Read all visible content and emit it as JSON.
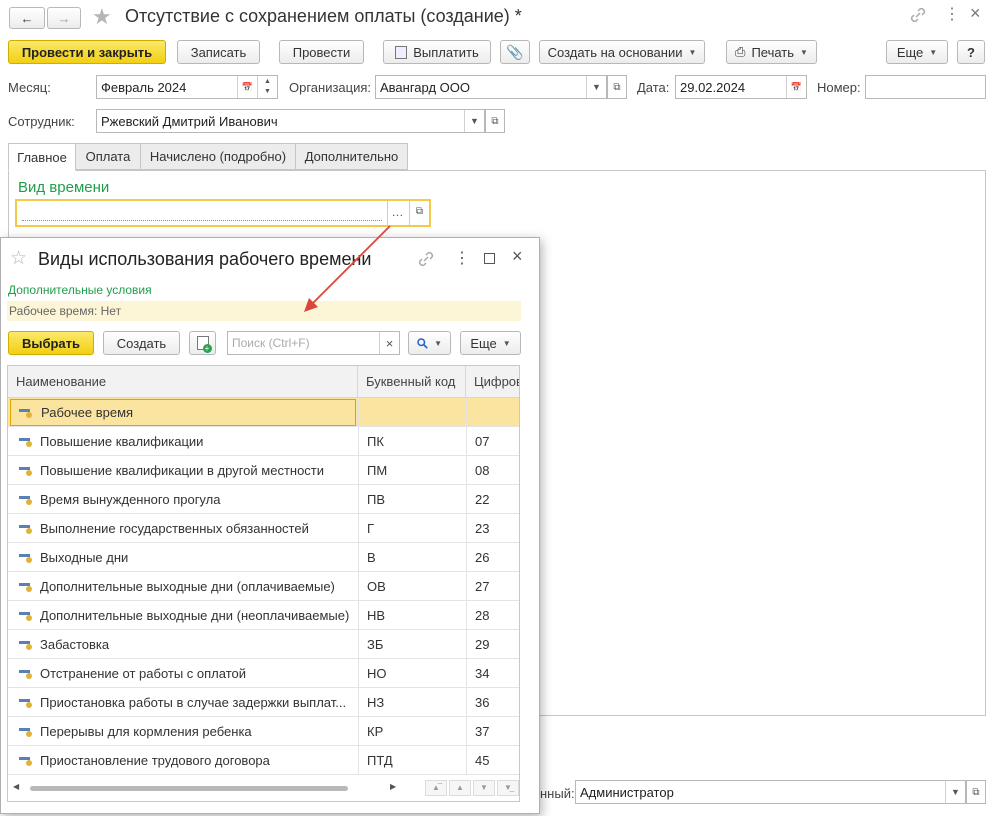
{
  "window": {
    "title": "Отсутствие с сохранением оплаты (создание) *"
  },
  "toolbar": {
    "post_close": "Провести и закрыть",
    "save": "Записать",
    "post": "Провести",
    "pay": "Выплатить",
    "create_based": "Создать на основании",
    "print": "Печать",
    "more": "Еще",
    "help": "?"
  },
  "form": {
    "month_label": "Месяц:",
    "month_value": "Февраль 2024",
    "org_label": "Организация:",
    "org_value": "Авангард ООО",
    "date_label": "Дата:",
    "date_value": "29.02.2024",
    "number_label": "Номер:",
    "number_value": "",
    "employee_label": "Сотрудник:",
    "employee_value": "Ржевский Дмитрий Иванович"
  },
  "tabs": [
    {
      "label": "Главное"
    },
    {
      "label": "Оплата"
    },
    {
      "label": "Начислено (подробно)"
    },
    {
      "label": "Дополнительно"
    }
  ],
  "main": {
    "time_type_label": "Вид времени",
    "time_type_value": "",
    "responsible_label": "нный:",
    "responsible_value": "Администратор"
  },
  "dialog": {
    "title": "Виды использования рабочего времени",
    "extra_conditions": "Дополнительные условия",
    "filter_text": "Рабочее время: Нет",
    "select_btn": "Выбрать",
    "create_btn": "Создать",
    "search_placeholder": "Поиск (Ctrl+F)",
    "more_btn": "Еще",
    "columns": [
      "Наименование",
      "Буквенный код",
      "Цифровой код"
    ],
    "rows": [
      {
        "name": "Рабочее время",
        "code": "",
        "num": ""
      },
      {
        "name": "Повышение квалификации",
        "code": "ПК",
        "num": "07"
      },
      {
        "name": "Повышение квалификации в другой местности",
        "code": "ПМ",
        "num": "08"
      },
      {
        "name": "Время вынужденного прогула",
        "code": "ПВ",
        "num": "22"
      },
      {
        "name": "Выполнение государственных обязанностей",
        "code": "Г",
        "num": "23"
      },
      {
        "name": "Выходные дни",
        "code": "В",
        "num": "26"
      },
      {
        "name": "Дополнительные выходные дни (оплачиваемые)",
        "code": "ОВ",
        "num": "27"
      },
      {
        "name": "Дополнительные выходные дни (неоплачиваемые)",
        "code": "НВ",
        "num": "28"
      },
      {
        "name": "Забастовка",
        "code": "ЗБ",
        "num": "29"
      },
      {
        "name": "Отстранение от работы с оплатой",
        "code": "НО",
        "num": "34"
      },
      {
        "name": "Приостановка работы в случае задержки выплат...",
        "code": "НЗ",
        "num": "36"
      },
      {
        "name": "Перерывы для кормления ребенка",
        "code": "КР",
        "num": "37"
      },
      {
        "name": "Приостановление трудового договора",
        "code": "ПТД",
        "num": "45"
      }
    ]
  },
  "colors": {
    "accent_yellow": "#f5d418",
    "green_text": "#1f9e4a",
    "selected_row": "#fbe4a0",
    "filter_bg": "#fcf6d7",
    "arrow": "#d9463a"
  },
  "icons": [
    "back-arrow-icon",
    "forward-arrow-icon",
    "star-icon",
    "link-icon",
    "kebab-menu-icon",
    "maximize-icon",
    "close-icon",
    "calendar-icon",
    "spin-up-icon",
    "spin-down-icon",
    "dropdown-arrow-icon",
    "open-icon",
    "paperclip-icon",
    "printer-icon",
    "pay-icon",
    "search-icon",
    "item-icon"
  ]
}
